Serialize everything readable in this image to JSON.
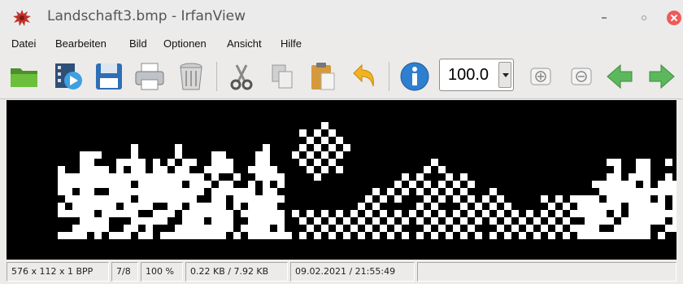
{
  "window": {
    "title": "Landschaft3.bmp - IrfanView"
  },
  "menu": {
    "items": [
      "Datei",
      "Bearbeiten",
      "Bild",
      "Optionen",
      "Ansicht",
      "Hilfe"
    ]
  },
  "toolbar": {
    "zoom_value": "100.0",
    "buttons": [
      "open",
      "slideshow",
      "save",
      "print",
      "delete",
      "cut",
      "copy",
      "paste",
      "undo",
      "info",
      "zoom-in",
      "zoom-out",
      "previous",
      "next"
    ]
  },
  "status": {
    "dimensions": "576 x 112 x 1 BPP",
    "index": "7/8",
    "zoom": "100 %",
    "size": "0.22 KB / 7.92 KB",
    "datetime": "09.02.2021 / 21:55:49"
  },
  "colors": {
    "canvas": "#000000",
    "pixels": "#ffffff",
    "close": "#ef5a5a",
    "arrow": "#5cb85c",
    "info": "#2f7fd0"
  }
}
